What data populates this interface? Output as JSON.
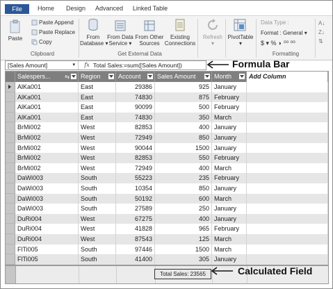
{
  "ribbon_tabs": [
    "File",
    "Home",
    "Design",
    "Advanced",
    "Linked Table"
  ],
  "clipboard": {
    "paste": "Paste",
    "paste_append": "Paste Append",
    "paste_replace": "Paste Replace",
    "copy": "Copy",
    "group_label": "Clipboard"
  },
  "external": {
    "from_database": "From\nDatabase ▾",
    "from_data_service": "From Data\nService ▾",
    "from_other_sources": "From Other\nSources",
    "existing_connections": "Existing\nConnections",
    "group_label": "Get External Data"
  },
  "refresh": {
    "label": "Refresh\n▾"
  },
  "pivottable": {
    "label": "PivotTable\n▾"
  },
  "formatting": {
    "data_type": "Data Type :",
    "format": "Format : General ▾",
    "symbols": "$ ▾  %  ◗  ⁰⁰  ⁰⁰",
    "group_label": "Formatting"
  },
  "formula_bar": {
    "name_box": "[Sales Amount]",
    "fx": "fx",
    "formula": "Total Sales:=sum([Sales Amount])"
  },
  "annotations": {
    "formula_bar": "Formula Bar",
    "calculated_field": "Calculated Field"
  },
  "columns": [
    "Salespers...",
    "Region",
    "Account",
    "Sales Amount",
    "Month",
    "Add Column"
  ],
  "rows": [
    [
      "AlKa001",
      "East",
      "29386",
      "925",
      "January"
    ],
    [
      "AlKa001",
      "East",
      "74830",
      "875",
      "February"
    ],
    [
      "AlKa001",
      "East",
      "90099",
      "500",
      "February"
    ],
    [
      "AlKa001",
      "East",
      "74830",
      "350",
      "March"
    ],
    [
      "BrMi002",
      "West",
      "82853",
      "400",
      "January"
    ],
    [
      "BrMi002",
      "West",
      "72949",
      "850",
      "January"
    ],
    [
      "BrMi002",
      "West",
      "90044",
      "1500",
      "January"
    ],
    [
      "BrMi002",
      "West",
      "82853",
      "550",
      "February"
    ],
    [
      "BrMi002",
      "West",
      "72949",
      "400",
      "March"
    ],
    [
      "DaWi003",
      "South",
      "55223",
      "235",
      "February"
    ],
    [
      "DaWi003",
      "South",
      "10354",
      "850",
      "January"
    ],
    [
      "DaWi003",
      "South",
      "50192",
      "600",
      "March"
    ],
    [
      "DaWi003",
      "South",
      "27589",
      "250",
      "January"
    ],
    [
      "DuRi004",
      "West",
      "67275",
      "400",
      "January"
    ],
    [
      "DuRi004",
      "West",
      "41828",
      "965",
      "February"
    ],
    [
      "DuRi004",
      "West",
      "87543",
      "125",
      "March"
    ],
    [
      "FlTi005",
      "South",
      "97446",
      "1500",
      "March"
    ],
    [
      "FlTi005",
      "South",
      "41400",
      "305",
      "January"
    ]
  ],
  "calculated_field": "Total Sales: 23565",
  "colors": {
    "file_tab": "#2b5797",
    "header_bg": "#7f7f7f",
    "alt_row": "#e6e6e6"
  }
}
